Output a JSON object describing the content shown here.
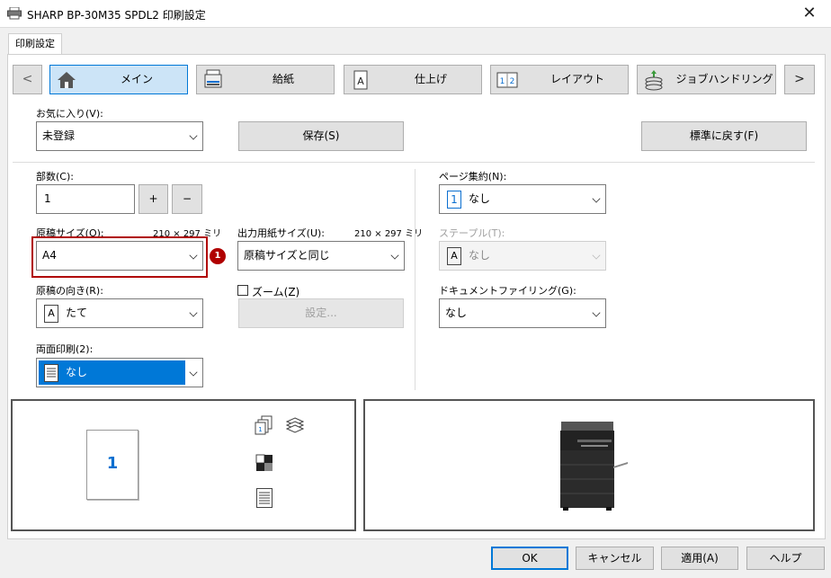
{
  "window": {
    "title": "SHARP BP-30M35 SPDL2 印刷設定",
    "close_symbol": "✕"
  },
  "tab": {
    "label": "印刷設定"
  },
  "nav": {
    "prev_symbol": "<",
    "next_symbol": ">",
    "items": [
      {
        "label": "メイン",
        "icon": "home-icon",
        "active": true
      },
      {
        "label": "給紙",
        "icon": "printer-tray-icon",
        "active": false
      },
      {
        "label": "仕上げ",
        "icon": "finish-a-icon",
        "active": false
      },
      {
        "label": "レイアウト",
        "icon": "layout-12-icon",
        "active": false
      },
      {
        "label": "ジョブハンドリング",
        "icon": "job-stack-icon",
        "active": false
      }
    ]
  },
  "favorites": {
    "label": "お気に入り(V):",
    "value": "未登録",
    "save": "保存(S)",
    "reset": "標準に戻す(F)"
  },
  "copies": {
    "label": "部数(C):",
    "value": "1",
    "plus": "+",
    "minus": "−"
  },
  "original_size": {
    "label": "原稿サイズ(O):",
    "dims": "210 × 297 ミリ",
    "value": "A4",
    "callout_number": "1"
  },
  "output_size": {
    "label": "出力用紙サイズ(U):",
    "dims": "210 × 297 ミリ",
    "value": "原稿サイズと同じ"
  },
  "orientation": {
    "label": "原稿の向き(R):",
    "value": "たて",
    "icon_letter": "A"
  },
  "zoom": {
    "label": "ズーム(Z)",
    "checked": false,
    "settings": "設定..."
  },
  "duplex": {
    "label": "両面印刷(2):",
    "value": "なし"
  },
  "pages_per_sheet": {
    "label": "ページ集約(N):",
    "value": "なし",
    "icon_number": "1"
  },
  "staple": {
    "label": "ステープル(T):",
    "value": "なし",
    "icon_letter": "A",
    "disabled": true
  },
  "doc_filing": {
    "label": "ドキュメントファイリング(G):",
    "value": "なし"
  },
  "preview": {
    "page_number": "1"
  },
  "footer": {
    "ok": "OK",
    "cancel": "キャンセル",
    "apply": "適用(A)",
    "help": "ヘルプ"
  },
  "colors": {
    "accent": "#0078d7",
    "highlight_box": "#b00000",
    "callout": "#b00000",
    "active_tab": "#cce4f7"
  }
}
